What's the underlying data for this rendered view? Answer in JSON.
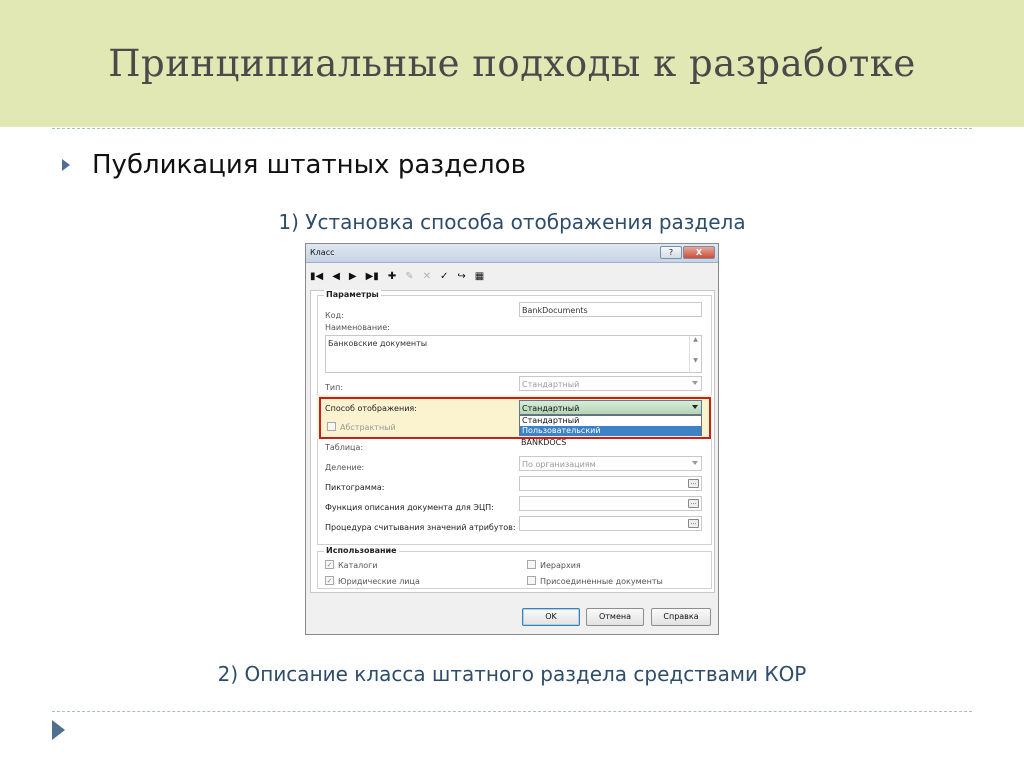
{
  "slide": {
    "title": "Принципиальные подходы к разработке",
    "bullet": "Публикация штатных разделов",
    "caption_top": "1) Установка способа отображения раздела",
    "caption_bottom": "2) Описание класса штатного раздела средствами КОР"
  },
  "dialog": {
    "title": "Класс",
    "help_label": "?",
    "close_label": "X",
    "toolbar": {
      "first_icon": "▮◀",
      "prev_icon": "◀",
      "next_icon": "▶",
      "last_icon": "▶▮",
      "add_icon": "✚",
      "edit_icon": "✎",
      "delete_icon": "✕",
      "confirm_icon": "✓",
      "redo_icon": "↪",
      "grid_icon": "▦"
    },
    "params": {
      "group_title": "Параметры",
      "code_label": "Код:",
      "code_value": "BankDocuments",
      "name_label": "Наименование:",
      "name_value": "Банковские документы",
      "type_label": "Тип:",
      "type_value": "Стандартный",
      "display_label": "Способ отображения:",
      "display_value": "Стандартный",
      "display_options": [
        "Стандартный",
        "Пользовательский"
      ],
      "abstract_label": "Абстрактный",
      "table_label": "Таблица:",
      "table_value": "BANKDOCS",
      "division_label": "Деление:",
      "division_value": "По организациям",
      "icon_label": "Пиктограмма:",
      "ecp_label": "Функция описания документа для ЭЦП:",
      "attr_label": "Процедура считывания значений атрибутов:",
      "ellipsis": "..."
    },
    "usage": {
      "group_title": "Использование",
      "catalogs_label": "Каталоги",
      "legal_label": "Юридические лица",
      "hierarchy_label": "Иерархия",
      "attached_label": "Присоединенные документы",
      "check_mark": "✓"
    },
    "buttons": {
      "ok": "OK",
      "cancel": "Отмена",
      "help": "Справка"
    }
  }
}
